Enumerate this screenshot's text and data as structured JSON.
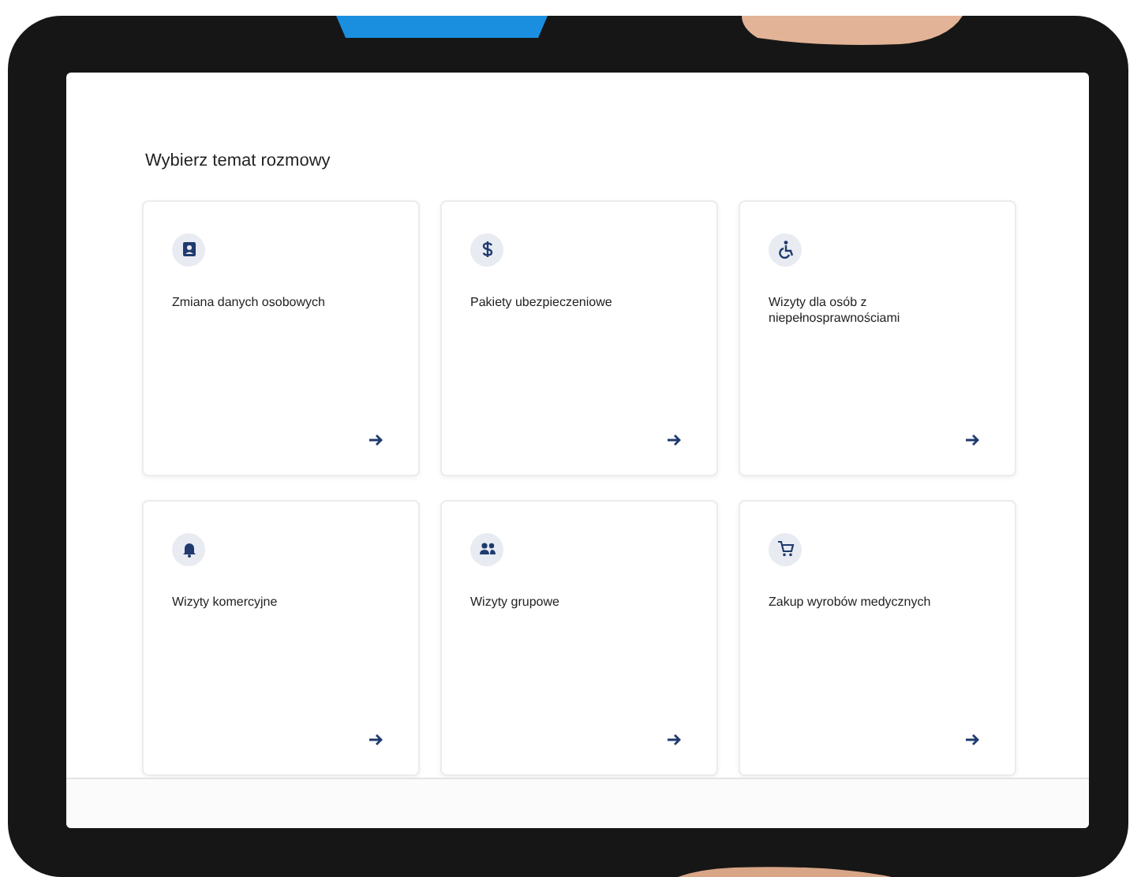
{
  "title": "Wybierz temat rozmowy",
  "topics": [
    {
      "kind": "id-card",
      "label": "Zmiana danych osobowych"
    },
    {
      "kind": "dollar",
      "label": "Pakiety ubezpieczeniowe"
    },
    {
      "kind": "wheelchair",
      "label": "Wizyty dla osób z niepełnosprawnościami"
    },
    {
      "kind": "bell",
      "label": "Wizyty komercyjne"
    },
    {
      "kind": "people",
      "label": "Wizyty grupowe"
    },
    {
      "kind": "cart",
      "label": "Zakup wyrobów medycznych"
    }
  ]
}
